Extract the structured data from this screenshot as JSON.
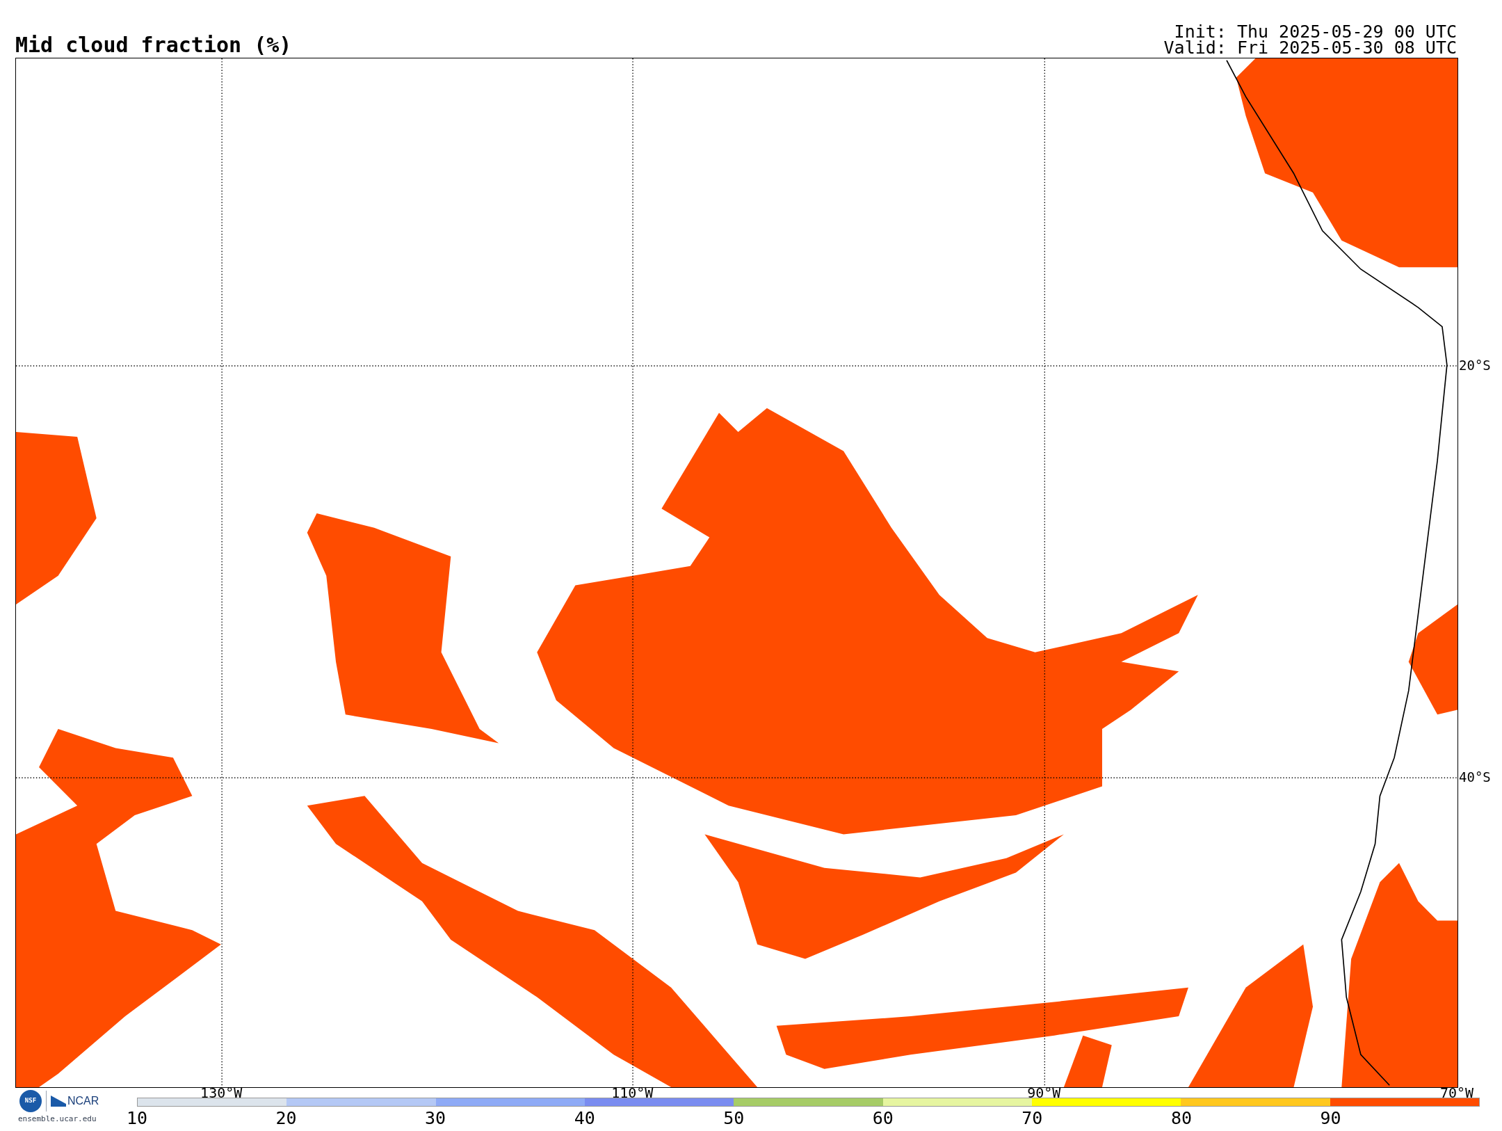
{
  "title": "Mid cloud fraction (%)",
  "init": "Init: Thu 2025-05-29 00 UTC",
  "valid": "Valid: Fri 2025-05-30 08 UTC",
  "map": {
    "longitude_labels": [
      "130°W",
      "110°W",
      "90°W",
      "70°W"
    ],
    "latitude_labels": [
      "20°S",
      "40°S"
    ]
  },
  "logos": {
    "nsf": "NSF",
    "ncar": "NCAR",
    "url": "ensemble.ucar.edu"
  },
  "colorbar": [
    {
      "label": "10",
      "color": "#dce4ec"
    },
    {
      "label": "20",
      "color": "#b4c8f5"
    },
    {
      "label": "30",
      "color": "#8eaaf6"
    },
    {
      "label": "40",
      "color": "#7a8cf0"
    },
    {
      "label": "50",
      "color": "#a6cc66"
    },
    {
      "label": "60",
      "color": "#e6f5a0"
    },
    {
      "label": "70",
      "color": "#ffff00"
    },
    {
      "label": "80",
      "color": "#ffc81e"
    },
    {
      "label": "90",
      "color": "#ff4c00"
    }
  ]
}
